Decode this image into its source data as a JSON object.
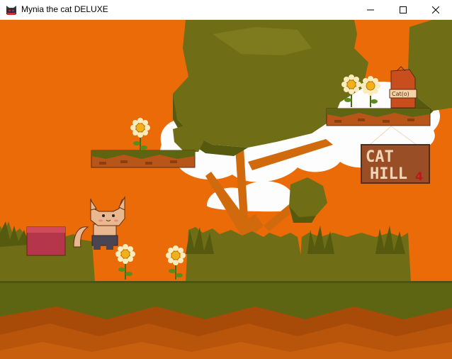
{
  "window": {
    "title": "Mynia the cat DELUXE",
    "app_icon": "cat-face-icon",
    "controls": {
      "minimize_icon": "minimize-icon",
      "maximize_icon": "maximize-icon",
      "close_icon": "close-icon"
    }
  },
  "scene": {
    "sign": {
      "line1": "CAT",
      "line2": "HILL",
      "number": "4"
    },
    "bag_label": "Cat(o)",
    "palette": {
      "sky": "#ea6b08",
      "cloud": "#fdfdfd",
      "foliage": "#6f6d16",
      "foliage_dark": "#565a0e",
      "grass": "#5d6513",
      "ground_stripe_1": "#a84a08",
      "ground_stripe_2": "#b8550a",
      "trunk": "#d06a0c",
      "brick": "#b8561a",
      "flower_petal": "#fbecbe",
      "flower_center": "#f2b11a",
      "cat_body": "#eab88e",
      "sign_board": "#9a4e26",
      "sign_text": "#f2d6b8"
    }
  }
}
